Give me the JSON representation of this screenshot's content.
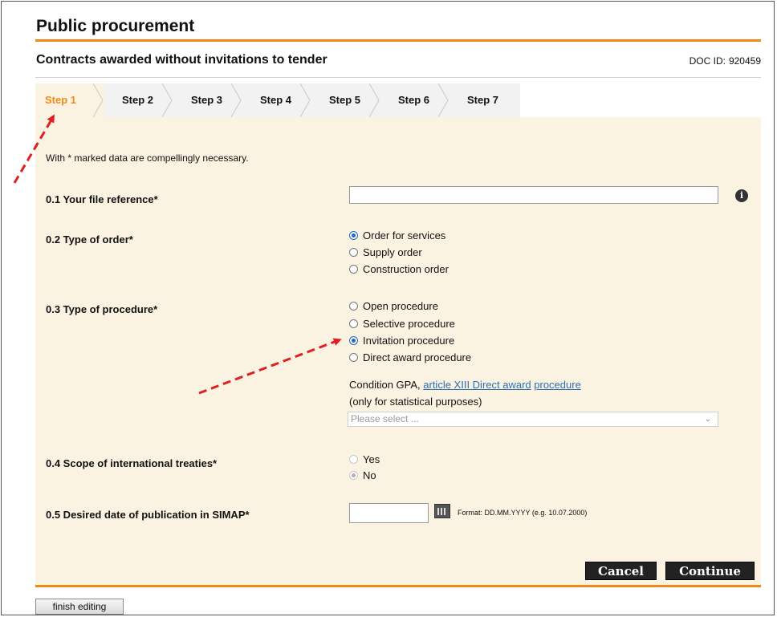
{
  "colors": {
    "accent": "#ef8a1a",
    "form_bg": "#fbf3e2",
    "link": "#2a6fb3",
    "arrow": "#e02020"
  },
  "header": {
    "title": "Public procurement",
    "subtitle": "Contracts awarded without invitations to tender",
    "doc_id_label": "DOC ID:",
    "doc_id_value": "920459"
  },
  "tabs": [
    {
      "label": "Step 1",
      "active": true
    },
    {
      "label": "Step 2"
    },
    {
      "label": "Step 3"
    },
    {
      "label": "Step 4"
    },
    {
      "label": "Step 5"
    },
    {
      "label": "Step 6"
    },
    {
      "label": "Step 7"
    }
  ],
  "form": {
    "note": "With * marked data are compellingly necessary.",
    "file_reference": {
      "label": "0.1 Your file reference*",
      "value": "",
      "info_icon": "i"
    },
    "order_type": {
      "label": "0.2 Type of order*",
      "options": [
        "Order for services",
        "Supply order",
        "Construction order"
      ],
      "selected": "Order for services"
    },
    "procedure_type": {
      "label": "0.3 Type of procedure*",
      "options": [
        "Open procedure",
        "Selective procedure",
        "Invitation procedure",
        "Direct award procedure"
      ],
      "selected": "Invitation procedure"
    },
    "condition": {
      "prefix": "Condition GPA,",
      "link1": "article XIII Direct award",
      "link2": "procedure",
      "note": "(only for statistical purposes)",
      "select_value": "Please select ..."
    },
    "treaties": {
      "label": "0.4 Scope of international treaties*",
      "options": [
        "Yes",
        "No"
      ],
      "selected": "No"
    },
    "publication_date": {
      "label": "0.5 Desired date of publication in SIMAP*",
      "value": "",
      "format": "Format: DD.MM.YYYY (e.g. 10.07.2000)"
    }
  },
  "buttons": {
    "cancel": "Cancel",
    "continue": "Continue",
    "finish": "finish editing"
  }
}
